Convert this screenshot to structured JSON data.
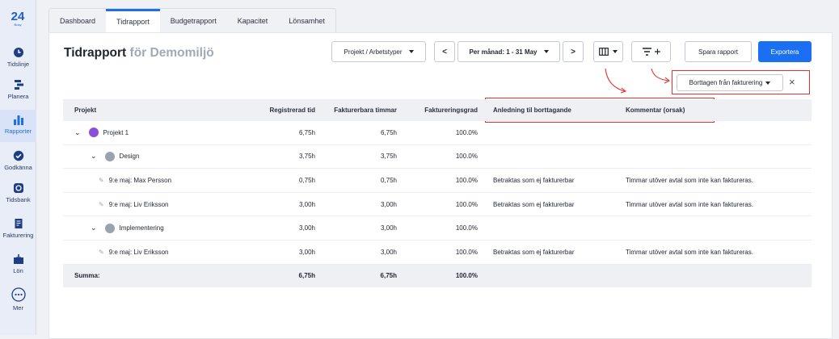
{
  "brand": {
    "logo": "24",
    "logo_sub": "Busy",
    "accent": "#1a6ff2"
  },
  "sidebar": {
    "items": [
      {
        "label": "Tidslinje",
        "icon": "clock-icon"
      },
      {
        "label": "Planera",
        "icon": "plan-icon"
      },
      {
        "label": "Rapporter",
        "icon": "bar-chart-icon",
        "active": true
      },
      {
        "label": "Godkänna",
        "icon": "check-circle-icon"
      },
      {
        "label": "Tidsbank",
        "icon": "timebank-icon"
      },
      {
        "label": "Fakturering",
        "icon": "invoice-icon"
      },
      {
        "label": "Lön",
        "icon": "salary-icon"
      },
      {
        "label": "Mer",
        "icon": "more-icon"
      }
    ]
  },
  "tabs": [
    "Dashboard",
    "Tidrapport",
    "Budgetrapport",
    "Kapacitet",
    "Lönsamhet"
  ],
  "active_tab": "Tidrapport",
  "header": {
    "title": "Tidrapport",
    "subtitle": "för Demomiljö",
    "groupby": "Projekt / Arbetstyper",
    "period": "Per månad: 1 - 31 May",
    "prev": "<",
    "next": ">",
    "save": "Spara rapport",
    "export": "Exportera",
    "filter_tag": "Borttagen från fakturering",
    "filter_remove": "×"
  },
  "table": {
    "columns": [
      "Projekt",
      "Registrerad tid",
      "Fakturerbara timmar",
      "Faktureringsgrad",
      "Anledning til borttagande",
      "Kommentar (orsak)"
    ],
    "rows": [
      {
        "level": 0,
        "name": "Projekt 1",
        "reg": "6,75h",
        "fakt": "6,75h",
        "grad": "100.0%",
        "reason": "",
        "comment": ""
      },
      {
        "level": 1,
        "name": "Design",
        "reg": "3,75h",
        "fakt": "3,75h",
        "grad": "100.0%",
        "reason": "",
        "comment": ""
      },
      {
        "level": 2,
        "name": "9:e maj: Max Persson",
        "reg": "0,75h",
        "fakt": "0,75h",
        "grad": "100.0%",
        "reason": "Betraktas som ej fakturerbar",
        "comment": "Timmar utöver avtal som inte kan faktureras."
      },
      {
        "level": 2,
        "name": "9:e maj: Liv Eriksson",
        "reg": "3,00h",
        "fakt": "3,00h",
        "grad": "100.0%",
        "reason": "Betraktas som ej fakturerbar",
        "comment": "Timmar utöver avtal som inte kan faktureras."
      },
      {
        "level": 1,
        "name": "Implementering",
        "reg": "3,00h",
        "fakt": "3,00h",
        "grad": "100.0%",
        "reason": "",
        "comment": ""
      },
      {
        "level": 2,
        "name": "9:e maj: Liv Eriksson",
        "reg": "3,00h",
        "fakt": "3,00h",
        "grad": "100.0%",
        "reason": "Betraktas som ej fakturerbar",
        "comment": "Timmar utöver avtal som inte kan faktureras."
      }
    ],
    "sum": {
      "name": "Summa:",
      "reg": "6,75h",
      "fakt": "6,75h",
      "grad": "100.0%"
    }
  }
}
